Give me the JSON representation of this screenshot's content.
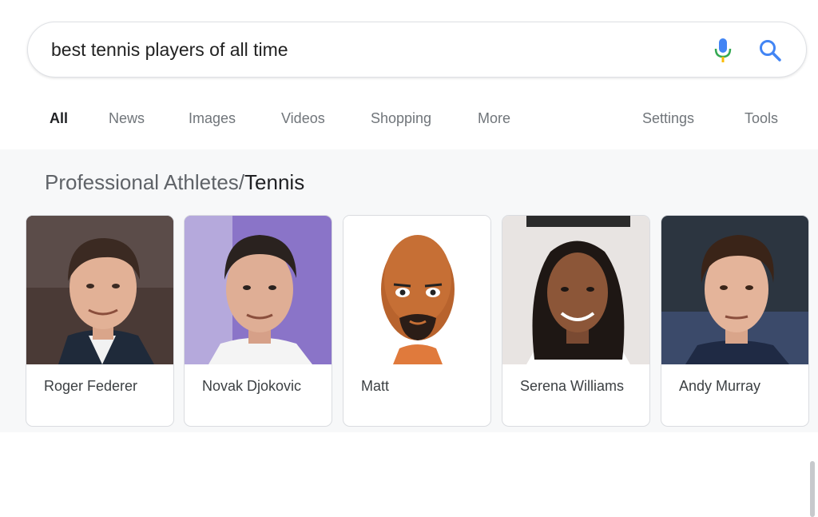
{
  "search": {
    "query": "best tennis players of all time"
  },
  "tabs": [
    {
      "label": "All",
      "active": true
    },
    {
      "label": "News"
    },
    {
      "label": "Images"
    },
    {
      "label": "Videos"
    },
    {
      "label": "Shopping"
    },
    {
      "label": "More"
    }
  ],
  "tools": {
    "settings": "Settings",
    "tools": "Tools"
  },
  "knowledge_panel": {
    "category": "Professional Athletes",
    "separator": "/",
    "subcategory": "Tennis"
  },
  "cards": [
    {
      "name": "Roger Federer",
      "icon": "person-photo"
    },
    {
      "name": "Novak Djokovic",
      "icon": "person-photo"
    },
    {
      "name": "Matt",
      "icon": "mii-avatar"
    },
    {
      "name": "Serena Williams",
      "icon": "person-photo"
    },
    {
      "name": "Andy Murray",
      "icon": "person-photo"
    }
  ],
  "colors": {
    "mic_blue": "#4285f4",
    "panel_bg": "#f7f8f9",
    "text_gray": "#70757a"
  }
}
